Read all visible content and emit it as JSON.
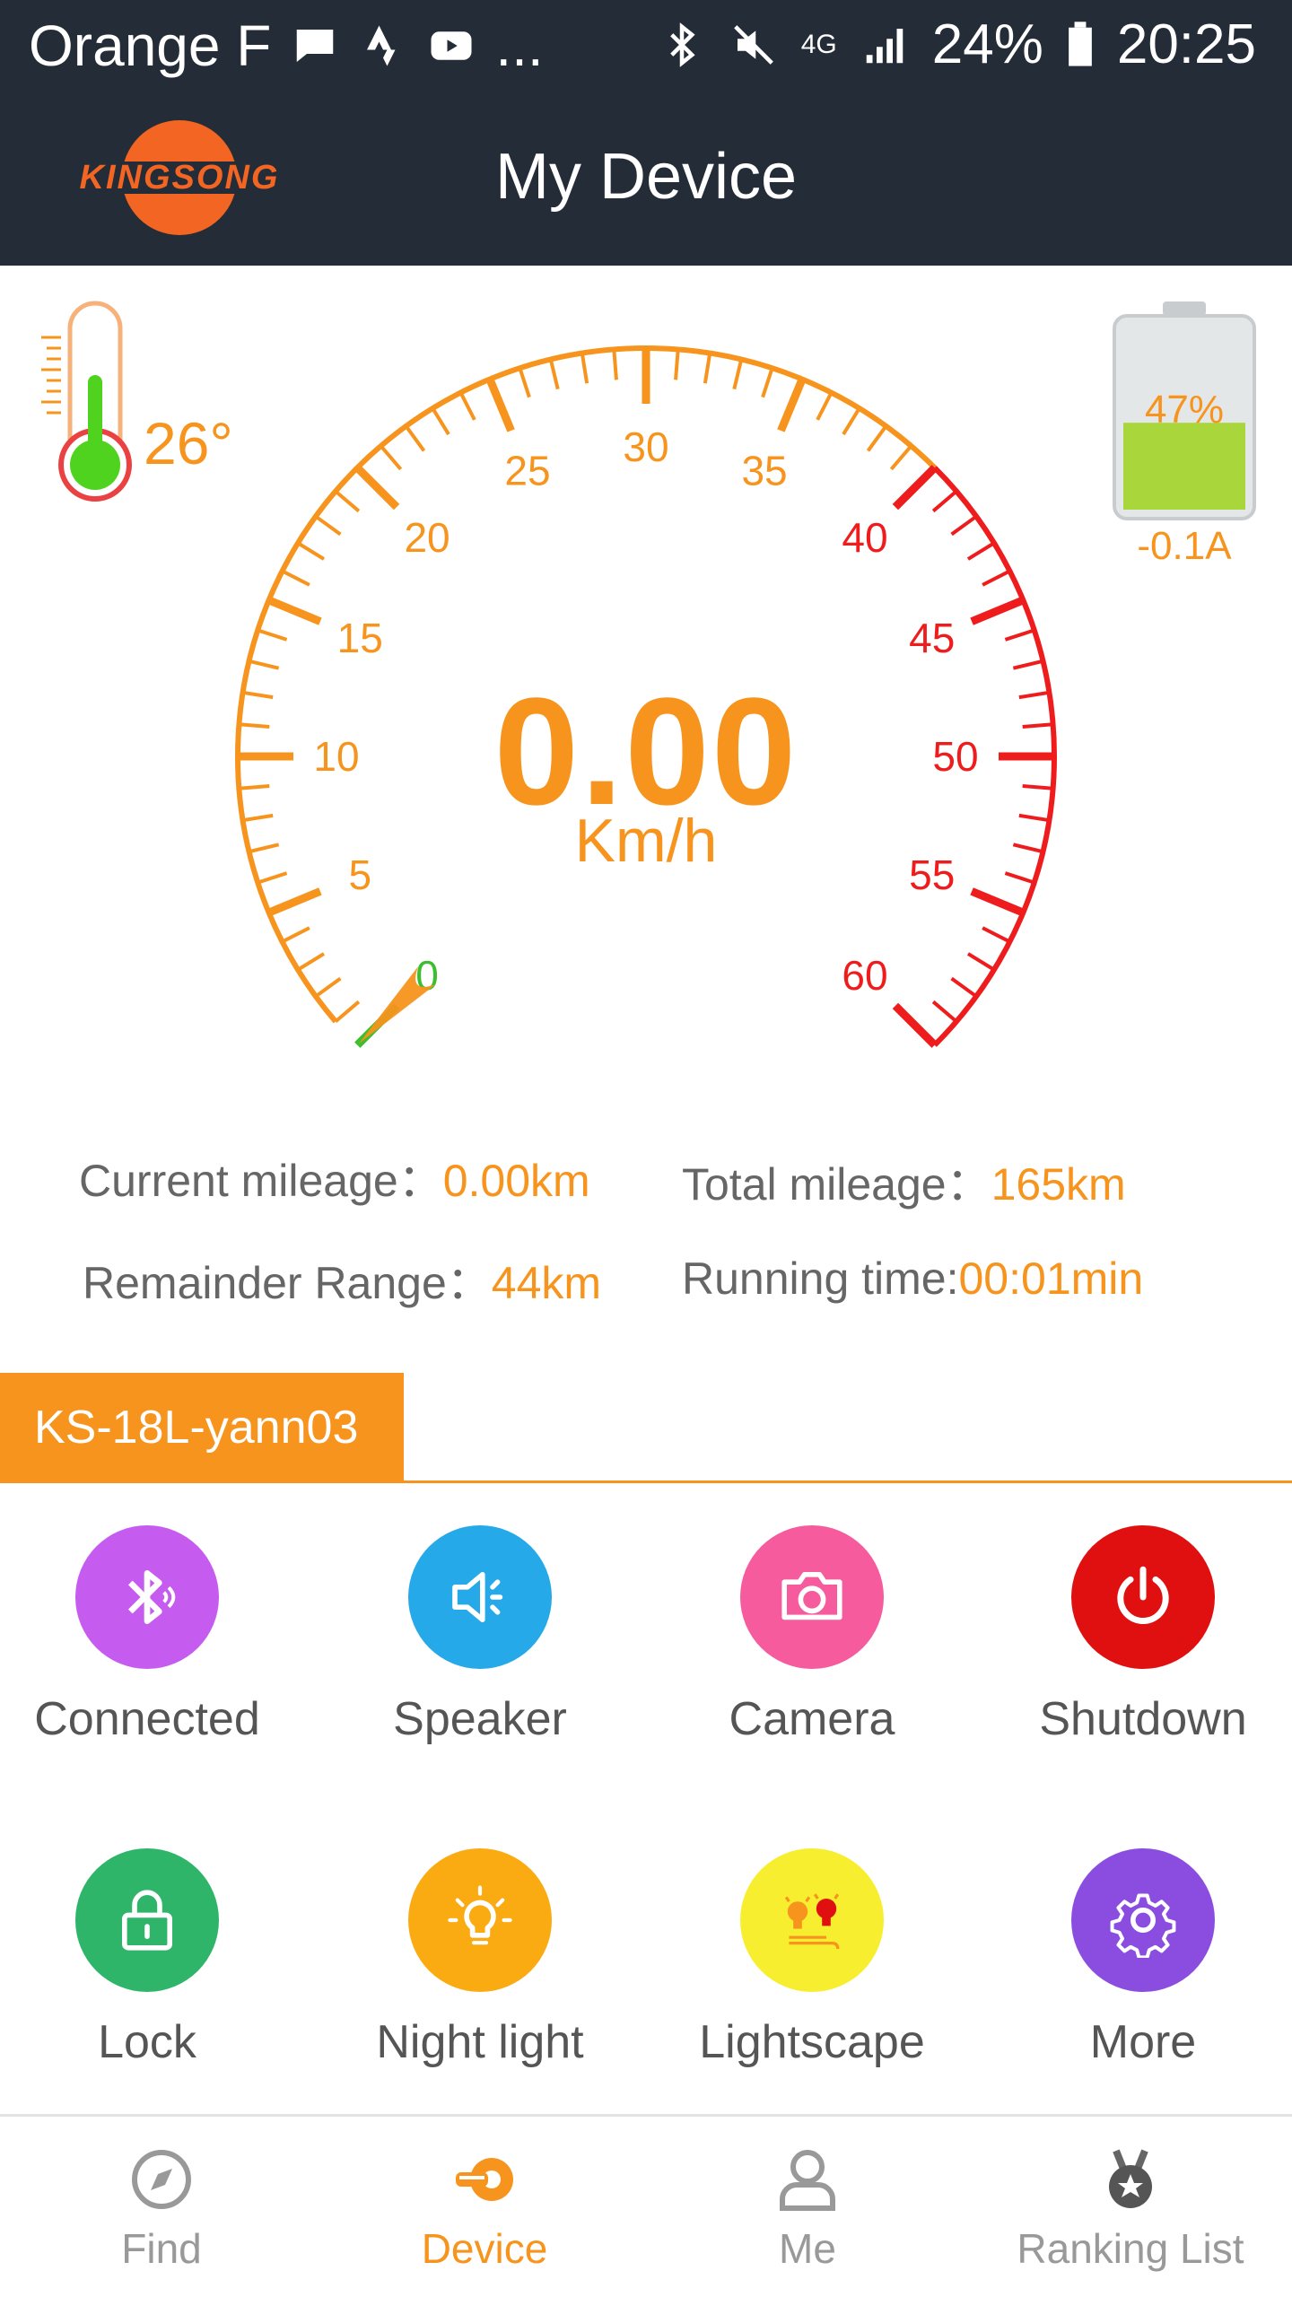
{
  "status_bar": {
    "carrier": "Orange F",
    "more": "...",
    "battery": "24%",
    "time": "20:25",
    "network": "4G"
  },
  "app_bar": {
    "title": "My Device",
    "logo_text": "KINGSONG"
  },
  "gauge": {
    "temperature": "26°",
    "battery_percent": "47%",
    "battery_level": 0.47,
    "current": "-0.1A",
    "speed": "0.00",
    "unit": "Km/h",
    "scale_labels": [
      "0",
      "5",
      "10",
      "15",
      "20",
      "25",
      "30",
      "35",
      "40",
      "45",
      "50",
      "55",
      "60"
    ],
    "max": 60,
    "warning_from": 40,
    "colors": {
      "normal": "#f7941d",
      "warning": "#ee1c1c",
      "zero": "#3cbf2e"
    }
  },
  "stats": {
    "current_mileage_label": "Current mileage：",
    "current_mileage_value": "0.00km",
    "total_mileage_label": "Total mileage：",
    "total_mileage_value": "165km",
    "remainder_range_label": "Remainder Range：",
    "remainder_range_value": "44km",
    "running_time_label": "Running time:",
    "running_time_value": "00:01min"
  },
  "device_name": "KS-18L-yann03",
  "actions": [
    {
      "label": "Connected",
      "icon": "bluetooth-icon",
      "color": "#c65bf0"
    },
    {
      "label": "Speaker",
      "icon": "speaker-icon",
      "color": "#26a9e8"
    },
    {
      "label": "Camera",
      "icon": "camera-icon",
      "color": "#f55b9d"
    },
    {
      "label": "Shutdown",
      "icon": "power-icon",
      "color": "#e01010"
    },
    {
      "label": "Lock",
      "icon": "lock-icon",
      "color": "#2fb56a"
    },
    {
      "label": "Night light",
      "icon": "bulb-icon",
      "color": "#fbab12"
    },
    {
      "label": "Lightscape",
      "icon": "lightscape-icon",
      "color": "#f8ee30"
    },
    {
      "label": "More",
      "icon": "gear-icon",
      "color": "#8a4de0"
    }
  ],
  "bottom_nav": [
    {
      "label": "Find",
      "icon": "compass-icon",
      "active": false
    },
    {
      "label": "Device",
      "icon": "wheel-icon",
      "active": true
    },
    {
      "label": "Me",
      "icon": "user-icon",
      "active": false
    },
    {
      "label": "Ranking List",
      "icon": "medal-icon",
      "active": false
    }
  ]
}
